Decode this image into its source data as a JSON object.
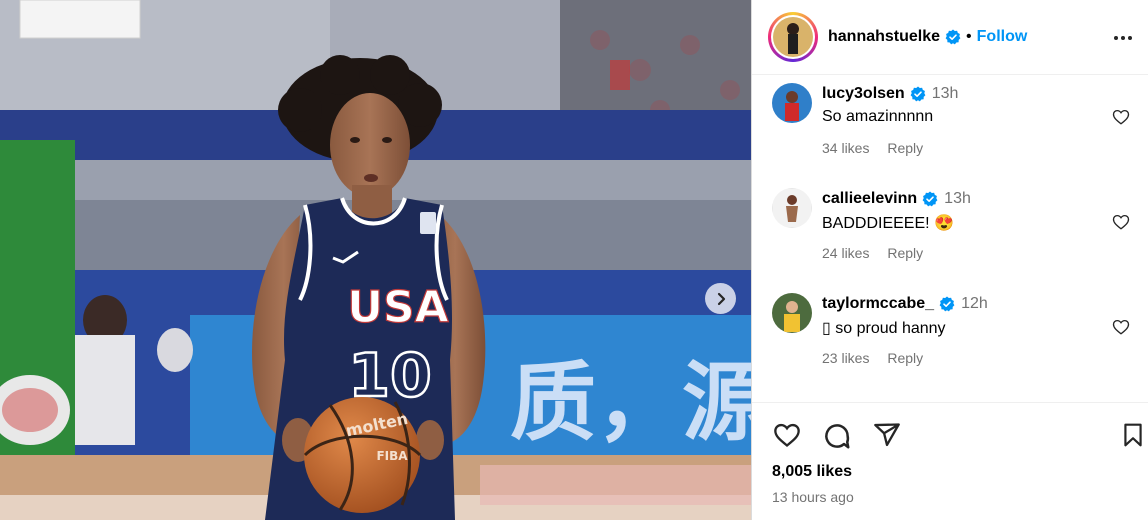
{
  "post": {
    "username": "hannahstuelke",
    "follow_label": "Follow",
    "separator": "•",
    "likes": "8,005 likes",
    "time_ago": "13 hours ago"
  },
  "comments": [
    {
      "username": "lucy3olsen",
      "time": "13h",
      "text": "So amazinnnnn",
      "likes": "34 likes",
      "reply": "Reply"
    },
    {
      "username": "callieelevinn",
      "time": "13h",
      "text": "BADDDIEEEE! 😍",
      "likes": "24 likes",
      "reply": "Reply"
    },
    {
      "username": "taylormccabe_",
      "time": "12h",
      "text": "▯ so proud hanny",
      "likes": "23 likes",
      "reply": "Reply"
    }
  ],
  "photo": {
    "jersey_text": "USA",
    "jersey_number": "10",
    "ball_brand": "molten",
    "ball_label": "FIBA",
    "banner_text": "质，源"
  },
  "colors": {
    "accent": "#0095f6",
    "verified": "#0095f6",
    "jersey": "#1d2a57",
    "court_banner": "#2f86d1"
  },
  "icons": [
    "verified-badge-icon",
    "more-options-icon",
    "heart-icon",
    "comment-icon",
    "share-icon",
    "save-bookmark-icon",
    "chevron-right-icon"
  ]
}
